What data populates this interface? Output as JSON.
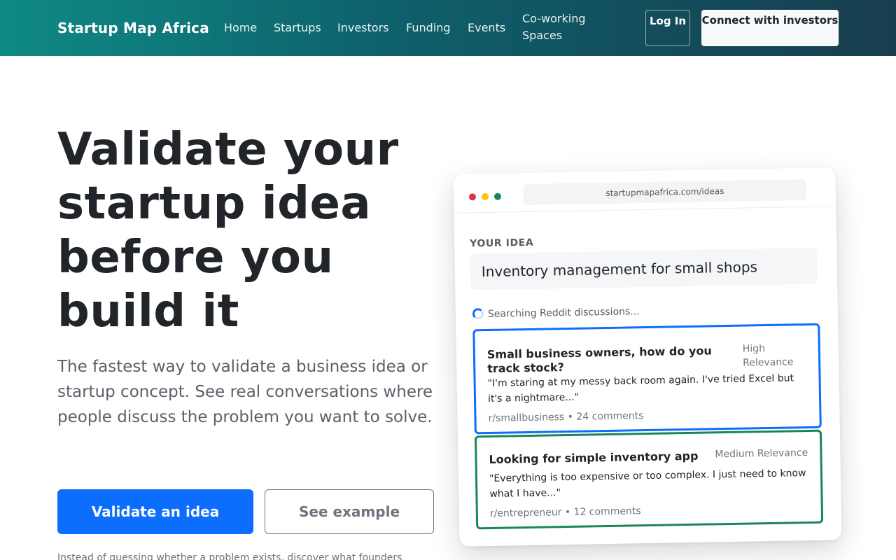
{
  "nav": {
    "brand": "Startup Map Africa",
    "links": [
      "Home",
      "Startups",
      "Investors",
      "Funding",
      "Events",
      "Co-working Spaces"
    ],
    "login_label": "Log In",
    "connect_label": "Connect with investors"
  },
  "hero": {
    "title": "Validate your startup idea before you build it",
    "subtitle": "The fastest way to validate a business idea or startup concept. See real conversations where people discuss the problem you want to solve.",
    "primary_label": "Validate an idea",
    "secondary_label": "See example",
    "footnote": "Instead of guessing whether a problem exists, discover what founders"
  },
  "mockup": {
    "url": "startupmapafrica.com/ideas",
    "idea_label": "YOUR IDEA",
    "idea_value": "Inventory management for small shops",
    "status": "Searching Reddit discussions...",
    "results": [
      {
        "title": "Small business owners, how do you track stock?",
        "relevance": "High Relevance",
        "quote": "\"I'm staring at my messy back room again. I've tried Excel but it's a nightmare...\"",
        "meta": "r/smallbusiness • 24 comments",
        "accent": "#0d6efd"
      },
      {
        "title": "Looking for simple inventory app",
        "relevance": "Medium Relevance",
        "quote": "\"Everything is too expensive or too complex. I just need to know what I have...\"",
        "meta": "r/entrepreneur • 12 comments",
        "accent": "#198754"
      }
    ]
  },
  "colors": {
    "navbar_start": "#0f8a85",
    "navbar_end": "#183d4e",
    "primary": "#0d6efd",
    "success": "#198754"
  }
}
